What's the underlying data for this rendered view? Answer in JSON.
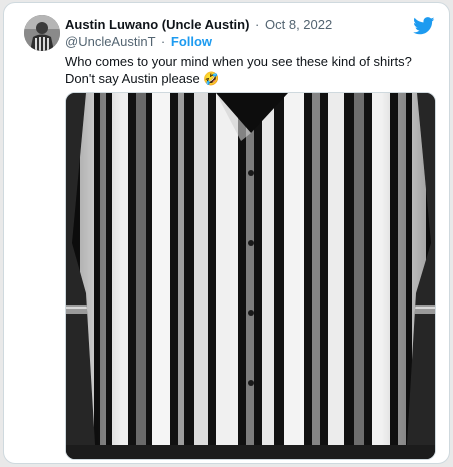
{
  "tweet": {
    "display_name": "Austin Luwano (Uncle Austin)",
    "separator": "·",
    "date": "Oct 8, 2022",
    "handle": "@UncleAustinT",
    "follow_label": "Follow",
    "text": "Who comes to your mind when you see these kind of shirts? Don't say Austin please 🤣"
  },
  "icons": {
    "brand": "twitter-bird-icon",
    "avatar": "profile-avatar"
  },
  "colors": {
    "accent": "#1d9bf0",
    "text": "#0f1419",
    "muted": "#536471",
    "border": "#cfd9de"
  }
}
